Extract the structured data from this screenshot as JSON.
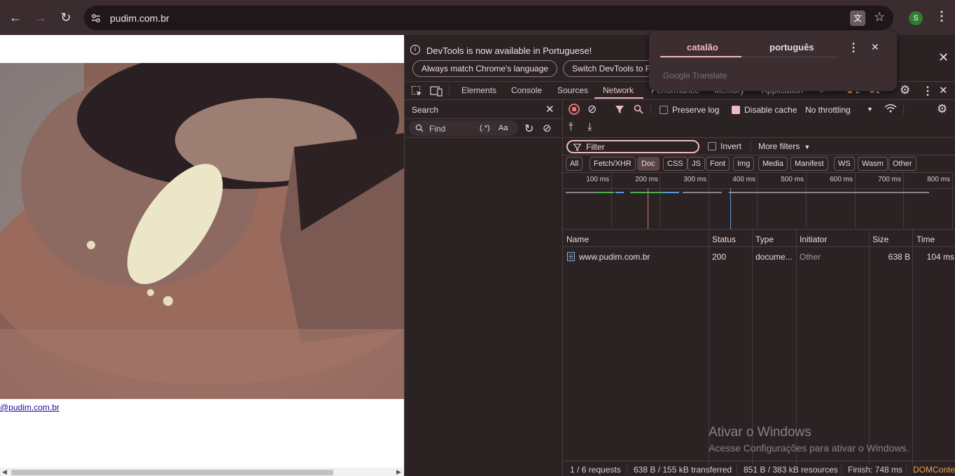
{
  "browser": {
    "url": "pudim.com.br",
    "profile_initial": "S",
    "icons": {
      "back": "arrow-left-icon",
      "forward": "arrow-right-icon",
      "reload": "reload-icon",
      "site_info": "tune-icon",
      "translate": "translate-icon",
      "bookmark": "star-icon",
      "menu": "kebab-menu-icon"
    }
  },
  "page": {
    "link_text": "@pudim.com.br"
  },
  "translate_popup": {
    "source_lang": "catalão",
    "target_lang": "português",
    "branding_google": "Google",
    "branding_translate": "Translate"
  },
  "devtools": {
    "infobar": {
      "message": "DevTools is now available in Portuguese!",
      "button_match": "Always match Chrome's language",
      "button_switch": "Switch DevTools to Portuguese"
    },
    "tabs": [
      "Elements",
      "Console",
      "Sources",
      "Network",
      "Performance",
      "Memory",
      "Application"
    ],
    "active_tab": "Network",
    "warnings_count": "2",
    "issues_count": "2",
    "search": {
      "title": "Search",
      "placeholder": "Find",
      "regex_label": "(.*)",
      "case_label": "Aa"
    },
    "toolbar": {
      "preserve_log": "Preserve log",
      "disable_cache": "Disable cache",
      "throttling": "No throttling",
      "filter_placeholder": "Filter",
      "invert": "Invert",
      "more_filters": "More filters"
    },
    "type_filters": [
      "All",
      "Fetch/XHR",
      "Doc",
      "CSS",
      "JS",
      "Font",
      "Img",
      "Media",
      "Manifest",
      "WS",
      "Wasm",
      "Other"
    ],
    "selected_filter": "Doc",
    "timeline_ticks": [
      "100 ms",
      "200 ms",
      "300 ms",
      "400 ms",
      "500 ms",
      "600 ms",
      "700 ms",
      "800 ms"
    ],
    "table": {
      "columns": [
        "Name",
        "Status",
        "Type",
        "Initiator",
        "Size",
        "Time"
      ],
      "rows": [
        {
          "name": "www.pudim.com.br",
          "status": "200",
          "type": "docume...",
          "initiator": "Other",
          "size": "638 B",
          "time": "104 ms"
        }
      ]
    },
    "statusbar": {
      "requests": "1 / 6 requests",
      "transferred": "638 B / 155 kB transferred",
      "resources": "851 B / 383 kB resources",
      "finish": "Finish: 748 ms",
      "domcontent": "DOMContentLoaded"
    }
  },
  "watermark": {
    "title": "Ativar o Windows",
    "subtitle": "Acesse Configurações para ativar o Windows."
  },
  "colors": {
    "accent": "#f2b8c6",
    "red_line": "#e57373",
    "blue_line": "#5b9bd5",
    "green": "#4caf50"
  }
}
